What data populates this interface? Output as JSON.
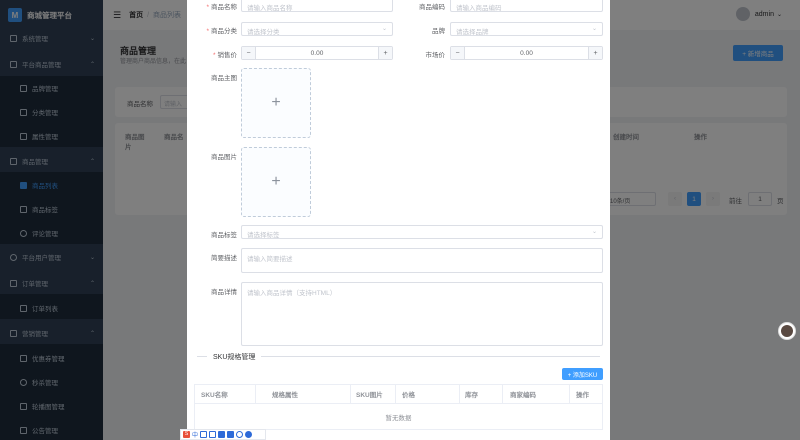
{
  "app": {
    "title": "商城管理平台",
    "logo_letter": "M"
  },
  "header": {
    "breadcrumb_home": "首页",
    "breadcrumb_current": "商品列表",
    "username": "admin"
  },
  "sidebar": {
    "items": [
      {
        "label": "系统管理",
        "level": 1
      },
      {
        "label": "平台商品管理",
        "level": 1
      },
      {
        "label": "品牌管理",
        "level": 2
      },
      {
        "label": "分类管理",
        "level": 2
      },
      {
        "label": "属性管理",
        "level": 2
      },
      {
        "label": "商品管理",
        "level": 1
      },
      {
        "label": "商品列表",
        "level": 2,
        "active": true
      },
      {
        "label": "商品标签",
        "level": 2
      },
      {
        "label": "评论管理",
        "level": 2
      },
      {
        "label": "平台用户管理",
        "level": 1
      },
      {
        "label": "订单管理",
        "level": 1
      },
      {
        "label": "订单列表",
        "level": 2
      },
      {
        "label": "营销管理",
        "level": 1
      },
      {
        "label": "优惠券管理",
        "level": 2
      },
      {
        "label": "秒杀管理",
        "level": 2
      },
      {
        "label": "轮播图管理",
        "level": 2
      },
      {
        "label": "公告管理",
        "level": 2
      }
    ]
  },
  "page": {
    "title": "商品管理",
    "subtitle": "管理商户商品信息，在此",
    "add_button": "+ 新增商品",
    "filter_label": "商品名称",
    "filter_placeholder": "请输入",
    "columns": {
      "image": "商品图片",
      "name": "商品名",
      "created": "创建时间",
      "actions": "操作"
    },
    "pager": {
      "size": "10条/页",
      "current": "1",
      "goto": "前往",
      "goto_value": "1",
      "page_unit": "页"
    }
  },
  "dialog": {
    "name_label": "商品名称",
    "name_placeholder": "请输入商品名称",
    "code_label": "商品编码",
    "code_placeholder": "请输入商品编码",
    "category_label": "商品分类",
    "category_placeholder": "请选择分类",
    "brand_label": "品牌",
    "brand_placeholder": "请选择品牌",
    "price_label": "销售价",
    "price_value": "0.00",
    "market_label": "市场价",
    "market_value": "0.00",
    "main_image_label": "商品主图",
    "images_label": "商品图片",
    "tags_label": "商品标签",
    "tags_placeholder": "请选择标签",
    "brief_label": "简要描述",
    "brief_placeholder": "请输入简要描述",
    "detail_label": "商品详情",
    "detail_placeholder": "请输入商品详情（支持HTML）",
    "sku_section": "SKU规格管理",
    "sku_add": "+ 添加SKU",
    "sku_columns": [
      "SKU名称",
      "规格属性",
      "SKU图片",
      "价格",
      "库存",
      "商家编码",
      "操作"
    ],
    "sku_empty": "暂无数据"
  },
  "toolbar": {
    "items": [
      "S",
      "中"
    ]
  }
}
